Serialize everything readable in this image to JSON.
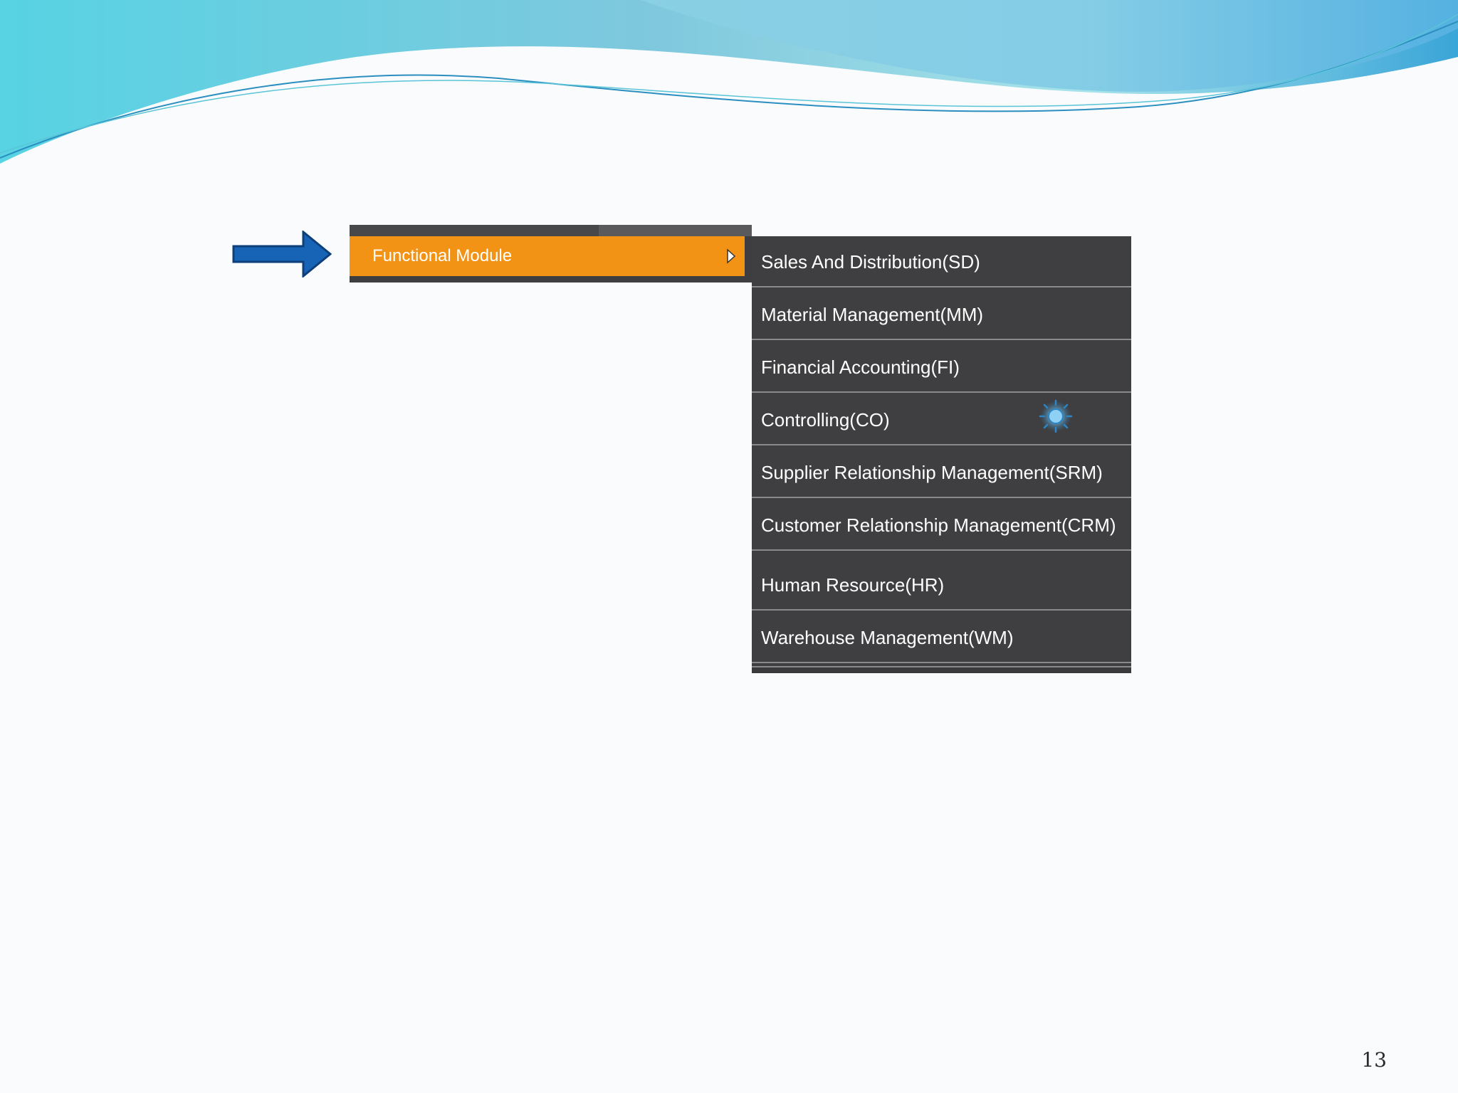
{
  "menu": {
    "active_item": "Functional Module"
  },
  "submenu": {
    "items": [
      "Sales And Distribution(SD)",
      "Material Management(MM)",
      "Financial Accounting(FI)",
      "Controlling(CO)",
      "Supplier Relationship Management(SRM)",
      "Customer Relationship Management(CRM)",
      "Human Resource(HR)",
      "Warehouse Management(WM)"
    ]
  },
  "slide": {
    "page_number": "13"
  },
  "colors": {
    "menu_background": "#3f3f41",
    "active_highlight": "#f39315",
    "arrow": "#1763b6",
    "wave_light": "#7fd7e6",
    "wave_deep": "#3aa5d8"
  },
  "icons": {
    "pointer": "right-arrow-icon",
    "submenu_indicator": "chevron-right-icon",
    "cursor": "cursor-glow-icon"
  }
}
